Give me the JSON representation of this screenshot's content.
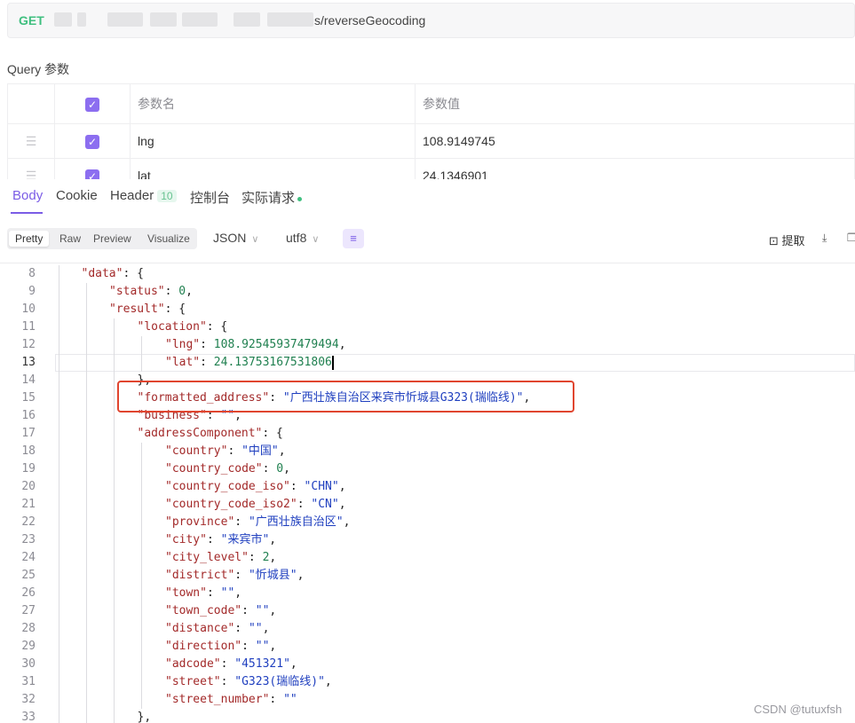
{
  "request": {
    "method": "GET",
    "url_visible": "s/reverseGeocoding"
  },
  "query": {
    "title": "Query 参数",
    "headers": {
      "name": "参数名",
      "value": "参数值"
    },
    "rows": [
      {
        "name": "lng",
        "value": "108.9149745",
        "checked": true
      },
      {
        "name": "lat",
        "value": "24.1346901",
        "checked": true
      }
    ]
  },
  "response_tabs": [
    {
      "label": "Body",
      "active": true
    },
    {
      "label": "Cookie"
    },
    {
      "label": "Header",
      "badge": "10"
    },
    {
      "label": "控制台"
    },
    {
      "label": "实际请求",
      "dot": true
    }
  ],
  "toolbar": {
    "views": [
      "Pretty",
      "Raw",
      "Preview",
      "Visualize"
    ],
    "active_view": "Pretty",
    "format": "JSON",
    "encoding": "utf8",
    "extract_label": "提取"
  },
  "code_lines": [
    {
      "no": "8",
      "indent": 1,
      "html": "<span class=\"k\">\"data\"</span><span class=\"p\">: {</span>"
    },
    {
      "no": "9",
      "indent": 2,
      "html": "<span class=\"k\">\"status\"</span><span class=\"p\">: </span><span class=\"n\">0</span><span class=\"p\">,</span>"
    },
    {
      "no": "10",
      "indent": 2,
      "html": "<span class=\"k\">\"result\"</span><span class=\"p\">: {</span>"
    },
    {
      "no": "11",
      "indent": 3,
      "html": "<span class=\"k\">\"location\"</span><span class=\"p\">: {</span>"
    },
    {
      "no": "12",
      "indent": 4,
      "html": "<span class=\"k\">\"lng\"</span><span class=\"p\">: </span><span class=\"n\">108.92545937479494</span><span class=\"p\">,</span>"
    },
    {
      "no": "13",
      "indent": 4,
      "current": true,
      "html": "<span class=\"k\">\"lat\"</span><span class=\"p\">: </span><span class=\"n\">24.13753167531806</span><span class=\"caret\"></span>"
    },
    {
      "no": "14",
      "indent": 3,
      "html": "<span class=\"p\">},</span>"
    },
    {
      "no": "15",
      "indent": 3,
      "html": "<span class=\"k\">\"formatted_address\"</span><span class=\"p\">: </span><span class=\"s\">\"广西壮族自治区来宾市忻城县G323(瑞临线)\"</span><span class=\"p\">,</span>"
    },
    {
      "no": "16",
      "indent": 3,
      "html": "<span class=\"k\">\"business\"</span><span class=\"p\">: </span><span class=\"s\">\"\"</span><span class=\"p\">,</span>"
    },
    {
      "no": "17",
      "indent": 3,
      "html": "<span class=\"k\">\"addressComponent\"</span><span class=\"p\">: {</span>"
    },
    {
      "no": "18",
      "indent": 4,
      "html": "<span class=\"k\">\"country\"</span><span class=\"p\">: </span><span class=\"s\">\"中国\"</span><span class=\"p\">,</span>"
    },
    {
      "no": "19",
      "indent": 4,
      "html": "<span class=\"k\">\"country_code\"</span><span class=\"p\">: </span><span class=\"n\">0</span><span class=\"p\">,</span>"
    },
    {
      "no": "20",
      "indent": 4,
      "html": "<span class=\"k\">\"country_code_iso\"</span><span class=\"p\">: </span><span class=\"s\">\"CHN\"</span><span class=\"p\">,</span>"
    },
    {
      "no": "21",
      "indent": 4,
      "html": "<span class=\"k\">\"country_code_iso2\"</span><span class=\"p\">: </span><span class=\"s\">\"CN\"</span><span class=\"p\">,</span>"
    },
    {
      "no": "22",
      "indent": 4,
      "html": "<span class=\"k\">\"province\"</span><span class=\"p\">: </span><span class=\"s\">\"广西壮族自治区\"</span><span class=\"p\">,</span>"
    },
    {
      "no": "23",
      "indent": 4,
      "html": "<span class=\"k\">\"city\"</span><span class=\"p\">: </span><span class=\"s\">\"来宾市\"</span><span class=\"p\">,</span>"
    },
    {
      "no": "24",
      "indent": 4,
      "html": "<span class=\"k\">\"city_level\"</span><span class=\"p\">: </span><span class=\"n\">2</span><span class=\"p\">,</span>"
    },
    {
      "no": "25",
      "indent": 4,
      "html": "<span class=\"k\">\"district\"</span><span class=\"p\">: </span><span class=\"s\">\"忻城县\"</span><span class=\"p\">,</span>"
    },
    {
      "no": "26",
      "indent": 4,
      "html": "<span class=\"k\">\"town\"</span><span class=\"p\">: </span><span class=\"s\">\"\"</span><span class=\"p\">,</span>"
    },
    {
      "no": "27",
      "indent": 4,
      "html": "<span class=\"k\">\"town_code\"</span><span class=\"p\">: </span><span class=\"s\">\"\"</span><span class=\"p\">,</span>"
    },
    {
      "no": "28",
      "indent": 4,
      "html": "<span class=\"k\">\"distance\"</span><span class=\"p\">: </span><span class=\"s\">\"\"</span><span class=\"p\">,</span>"
    },
    {
      "no": "29",
      "indent": 4,
      "html": "<span class=\"k\">\"direction\"</span><span class=\"p\">: </span><span class=\"s\">\"\"</span><span class=\"p\">,</span>"
    },
    {
      "no": "30",
      "indent": 4,
      "html": "<span class=\"k\">\"adcode\"</span><span class=\"p\">: </span><span class=\"s\">\"451321\"</span><span class=\"p\">,</span>"
    },
    {
      "no": "31",
      "indent": 4,
      "html": "<span class=\"k\">\"street\"</span><span class=\"p\">: </span><span class=\"s\">\"G323(瑞临线)\"</span><span class=\"p\">,</span>"
    },
    {
      "no": "32",
      "indent": 4,
      "html": "<span class=\"k\">\"street_number\"</span><span class=\"p\">: </span><span class=\"s\">\"\"</span>"
    },
    {
      "no": "33",
      "indent": 3,
      "html": "<span class=\"p\">},</span>"
    }
  ],
  "watermark": "CSDN @tutuxfsh",
  "colors": {
    "accent": "#7b5ce6",
    "method": "#3fbf7f",
    "highlight": "#e0452f"
  }
}
